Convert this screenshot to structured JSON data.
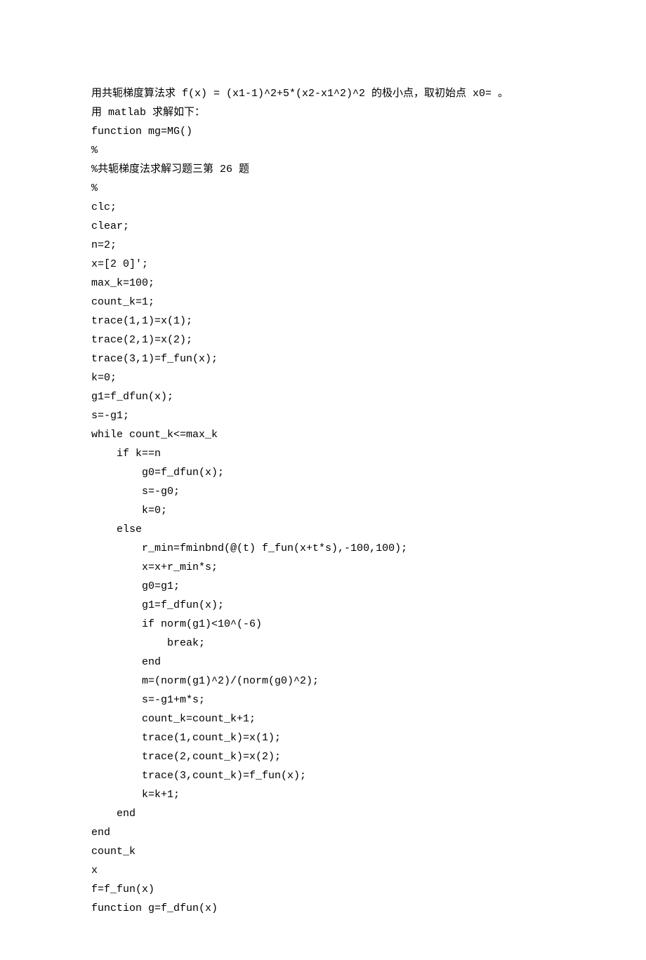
{
  "lines": [
    "用共轭梯度算法求 f(x) = (x1-1)^2+5*(x2-x1^2)^2 的极小点，取初始点 x0= 。",
    "用 matlab 求解如下：",
    "function mg=MG()",
    "%",
    "%共轭梯度法求解习题三第 26 题",
    "%",
    "clc;",
    "clear;",
    "n=2;",
    "x=[2 0]';",
    "max_k=100;",
    "count_k=1;",
    "trace(1,1)=x(1);",
    "trace(2,1)=x(2);",
    "trace(3,1)=f_fun(x);",
    "k=0;",
    "g1=f_dfun(x);",
    "s=-g1;",
    "while count_k<=max_k",
    "    if k==n",
    "        g0=f_dfun(x);",
    "        s=-g0;",
    "        k=0;",
    "    else",
    "        r_min=fminbnd(@(t) f_fun(x+t*s),-100,100);",
    "        x=x+r_min*s;",
    "        g0=g1;",
    "        g1=f_dfun(x);",
    "        if norm(g1)<10^(-6)",
    "            break;",
    "        end",
    "        m=(norm(g1)^2)/(norm(g0)^2);",
    "        s=-g1+m*s;",
    "        count_k=count_k+1;",
    "        trace(1,count_k)=x(1);",
    "        trace(2,count_k)=x(2);",
    "        trace(3,count_k)=f_fun(x);",
    "        k=k+1;",
    "    end",
    "end",
    "count_k",
    "x",
    "f=f_fun(x)",
    "function g=f_dfun(x)"
  ]
}
